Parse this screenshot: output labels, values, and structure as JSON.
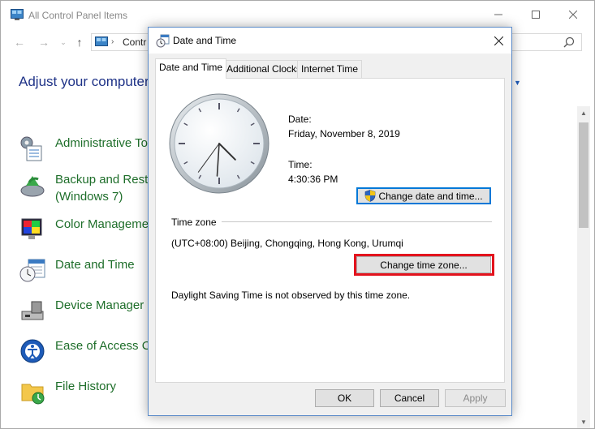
{
  "control_panel": {
    "title": "All Control Panel Items",
    "address_text": "Contr",
    "heading": "Adjust your computer's",
    "items": [
      {
        "label": "Administrative To",
        "icon": "administrative-tools-icon"
      },
      {
        "label": "Backup and Rest",
        "label2": "(Windows 7)",
        "icon": "backup-restore-icon"
      },
      {
        "label": "Color Manageme",
        "icon": "color-management-icon"
      },
      {
        "label": "Date and Time",
        "icon": "date-time-icon"
      },
      {
        "label": "Device Manager",
        "icon": "device-manager-icon"
      },
      {
        "label": "Ease of Access Ce",
        "icon": "ease-of-access-icon"
      },
      {
        "label": "File History",
        "icon": "file-history-icon"
      }
    ]
  },
  "dialog": {
    "title": "Date and Time",
    "tabs": [
      "Date and Time",
      "Additional Clocks",
      "Internet Time"
    ],
    "active_tab": "Date and Time",
    "date_label": "Date:",
    "date_value": "Friday, November 8, 2019",
    "time_label": "Time:",
    "time_value": "4:30:36 PM",
    "change_datetime_label": "Change date and time...",
    "timezone_label": "Time zone",
    "timezone_value": "(UTC+08:00) Beijing, Chongqing, Hong Kong, Urumqi",
    "change_timezone_label": "Change time zone...",
    "dst_text": "Daylight Saving Time is not observed by this time zone.",
    "ok_label": "OK",
    "cancel_label": "Cancel",
    "apply_label": "Apply"
  },
  "clock": {
    "hours": 4,
    "minutes": 30,
    "seconds": 36
  },
  "colors": {
    "accent": "#0078d7",
    "highlight": "#e3131d",
    "heading": "#1e3287",
    "item_link": "#1e6e2a"
  }
}
